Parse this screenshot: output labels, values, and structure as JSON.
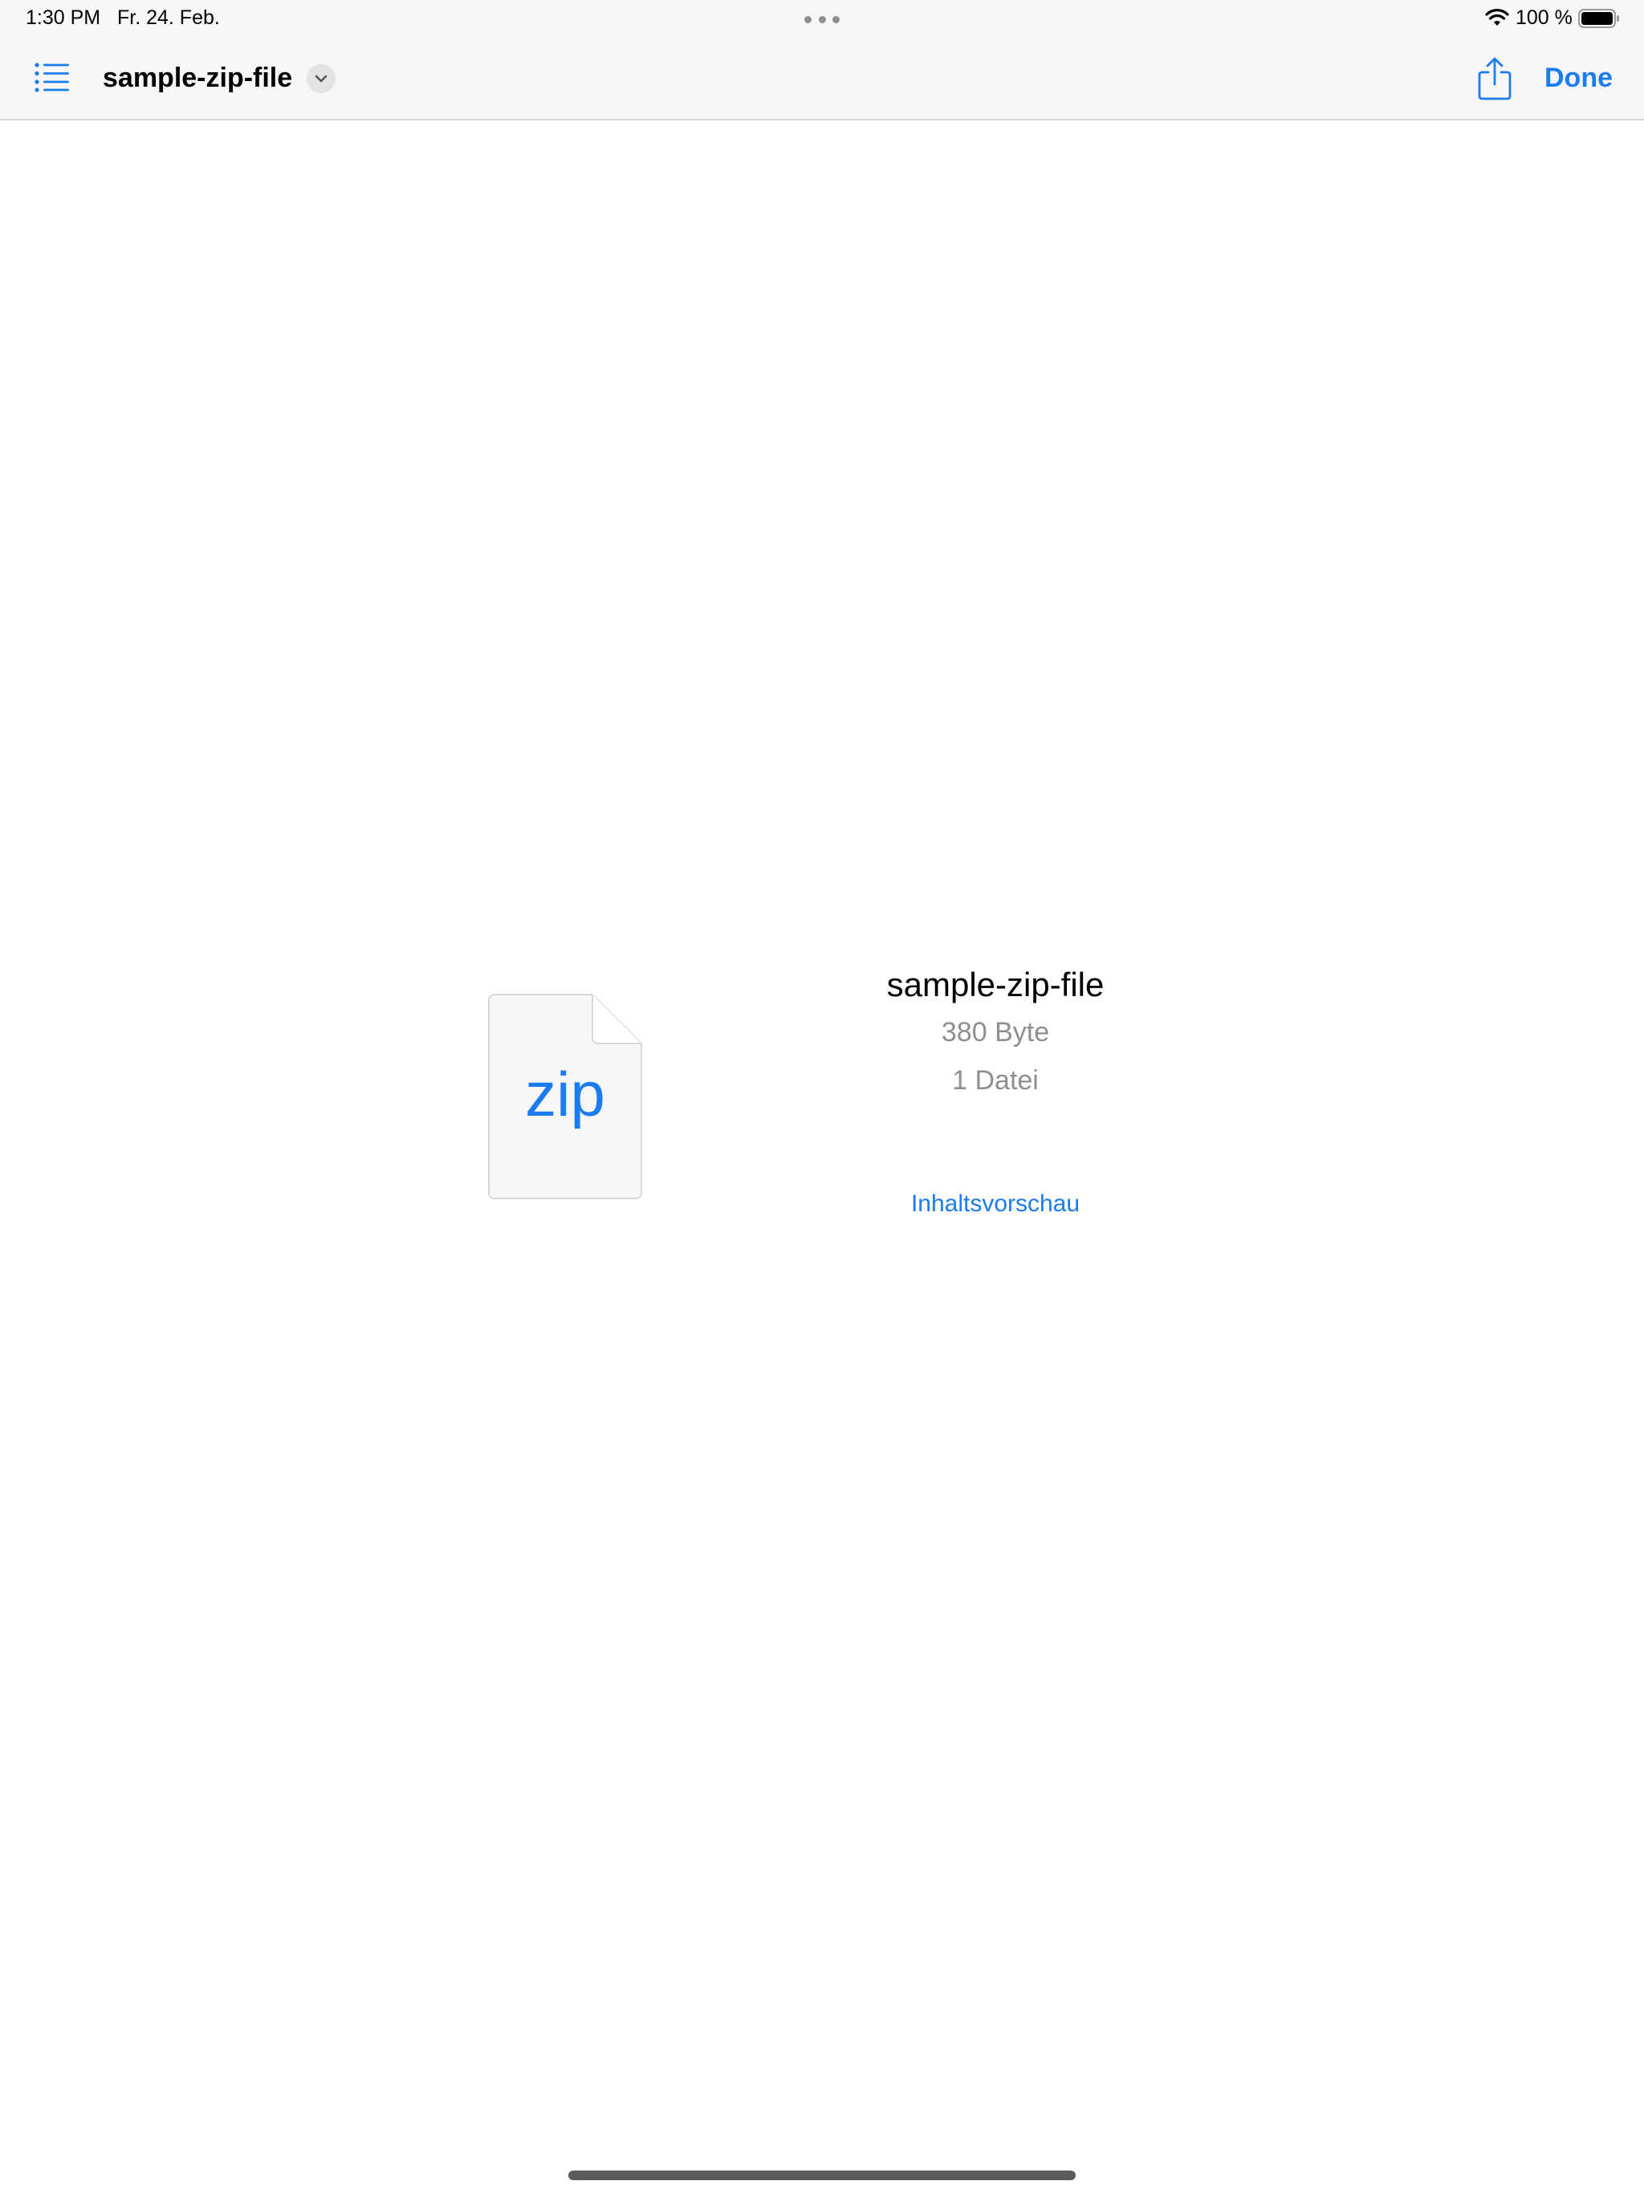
{
  "status_bar": {
    "time": "1:30 PM",
    "date": "Fr. 24. Feb.",
    "battery_percent": "100 %",
    "wifi_icon": "wifi-icon",
    "battery_icon": "battery-full-icon"
  },
  "nav": {
    "title": "sample-zip-file",
    "done_label": "Done",
    "sidebar_icon": "list-icon",
    "share_icon": "share-icon",
    "title_menu_icon": "chevron-down-icon"
  },
  "file": {
    "icon_label": "zip",
    "name": "sample-zip-file",
    "size": "380 Byte",
    "count": "1 Datei",
    "preview_link": "Inhaltsvorschau"
  },
  "colors": {
    "accent": "#1a7cf0",
    "secondary_text": "#8e8e93",
    "bar_background": "#f7f7f7"
  }
}
